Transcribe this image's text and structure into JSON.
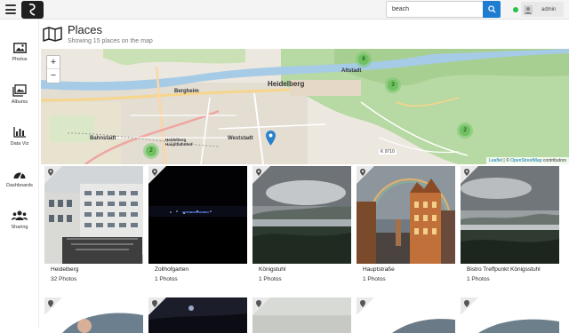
{
  "topbar": {
    "search_value": "beach",
    "user_name": "admin"
  },
  "sidebar": {
    "items": [
      {
        "label": "Photos",
        "icon": "photo-icon"
      },
      {
        "label": "Albums",
        "icon": "albums-icon"
      },
      {
        "label": "Data Viz",
        "icon": "bar-chart-icon"
      },
      {
        "label": "Dashboards",
        "icon": "dashboard-icon"
      },
      {
        "label": "Sharing",
        "icon": "users-icon"
      }
    ]
  },
  "header": {
    "title": "Places",
    "subtitle": "Showing 15 places on the map",
    "icon": "map-icon"
  },
  "map": {
    "zoom_in": "+",
    "zoom_out": "−",
    "labels": [
      "Heidelberg",
      "Altstadt",
      "Bergheim",
      "Weststadt",
      "Bahnstadt",
      "Heidelberg Hauptbahnhof",
      "K 9710"
    ],
    "clusters": [
      {
        "count": "8"
      },
      {
        "count": "3"
      },
      {
        "count": "2"
      },
      {
        "count": "2"
      }
    ],
    "attribution_leaflet": "Leaflet",
    "attribution_sep": " | © ",
    "attribution_osm": "OpenStreetMap",
    "attribution_tail": " contributors"
  },
  "places": [
    {
      "name": "Heidelberg",
      "count": "32 Photos"
    },
    {
      "name": "Zollhofgarten",
      "count": "1 Photos"
    },
    {
      "name": "Königstuhl",
      "count": "1 Photos"
    },
    {
      "name": "Hauptstraße",
      "count": "1 Photos"
    },
    {
      "name": "Bistro Treffpunkt Königsstuhl",
      "count": "1 Photos"
    }
  ],
  "colors": {
    "accent": "#1f7dd1",
    "online": "#27c24c",
    "cluster": "#6fc05f"
  }
}
